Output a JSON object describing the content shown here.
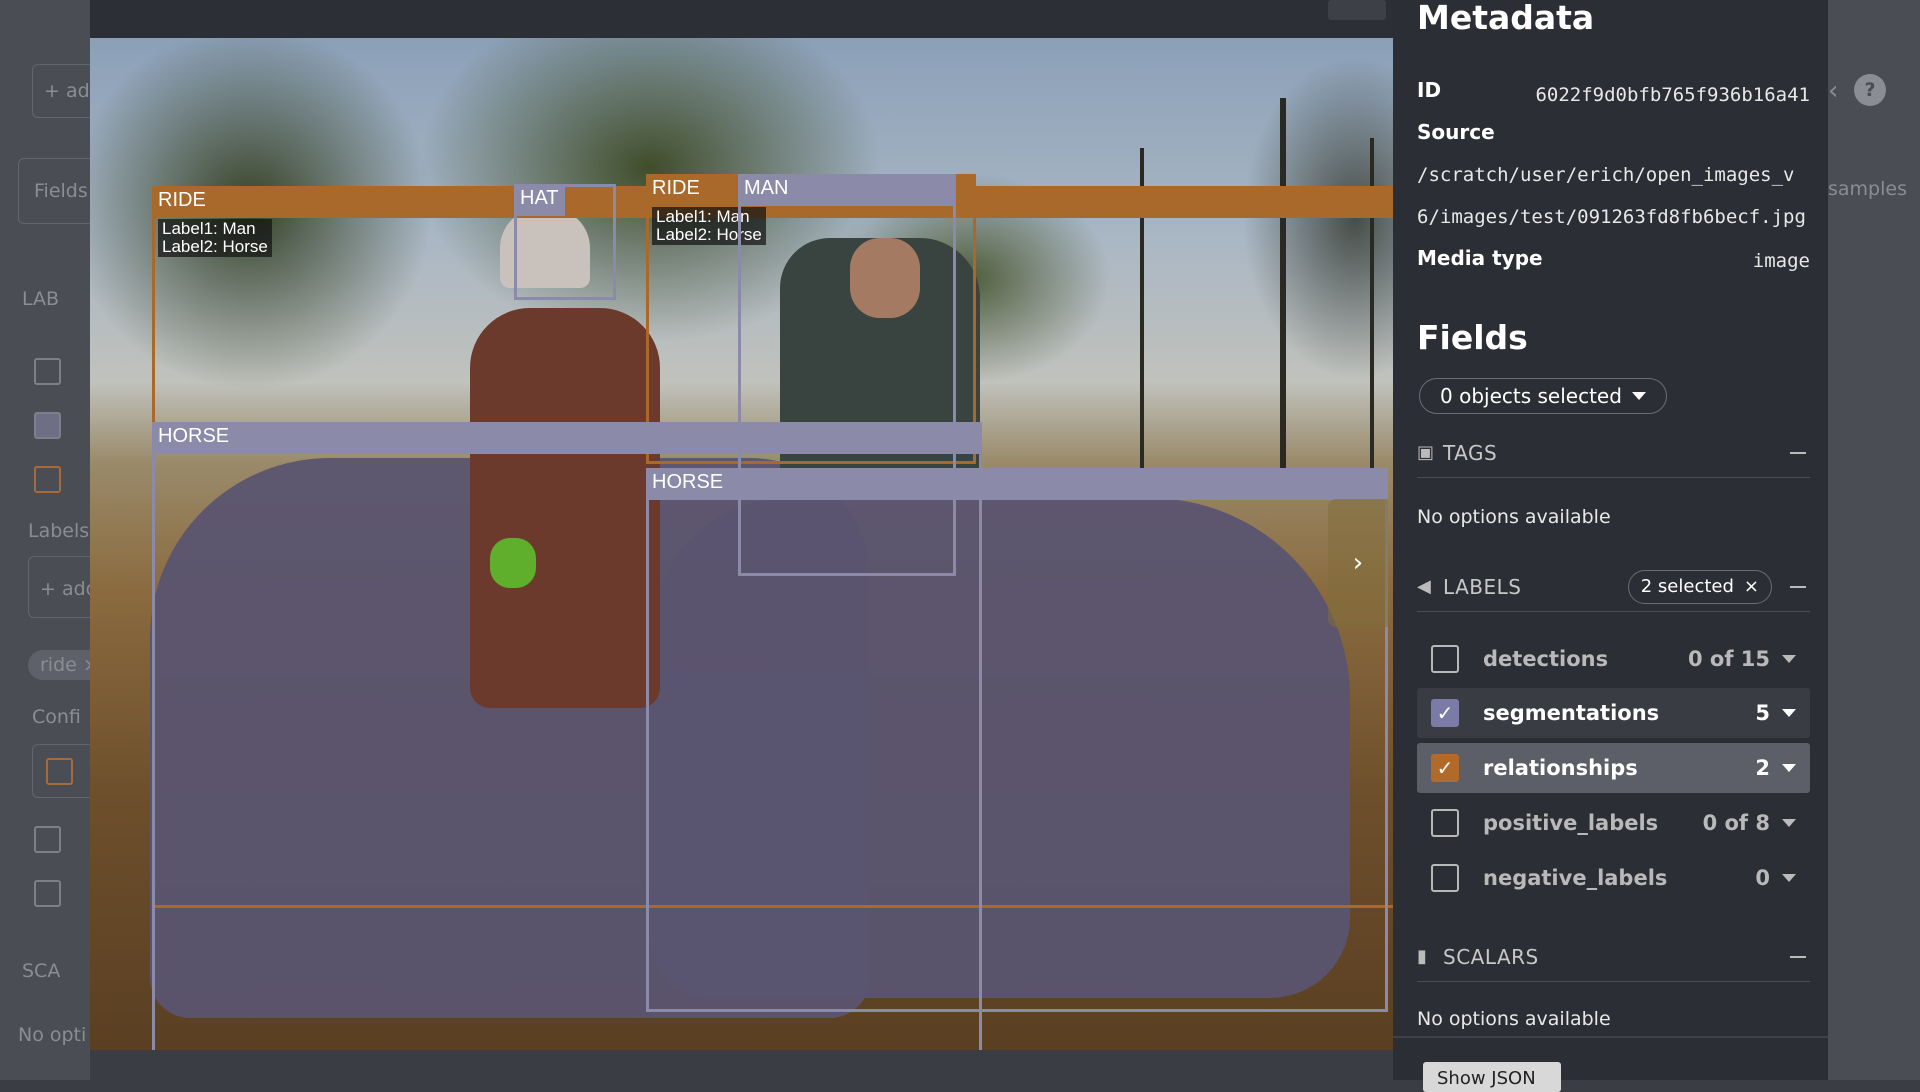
{
  "background_left": {
    "add_button": "+ add",
    "fields_label": "Fields",
    "labels_section": "LAB",
    "labels_filter": "Labels",
    "add_input": "+ add",
    "chip": "ride ×",
    "confidence": "Confi",
    "scalars": "SCA",
    "no_options": "No opti"
  },
  "background_right": {
    "samples_label": "samples",
    "help_icon": "?"
  },
  "viewer": {
    "boxes": [
      {
        "type": "ride",
        "label": "RIDE",
        "sub1": "Label1: Man",
        "sub2": "Label2: Horse"
      },
      {
        "type": "purple",
        "label": "HAT"
      },
      {
        "type": "ride",
        "label": "RIDE",
        "sub1": "Label1: Man",
        "sub2": "Label2: Horse"
      },
      {
        "type": "purple",
        "label": "MAN"
      },
      {
        "type": "purple",
        "label": "HORSE"
      },
      {
        "type": "purple",
        "label": "HORSE"
      }
    ],
    "next_arrow": "›"
  },
  "metadata": {
    "title": "Metadata",
    "id_label": "ID",
    "id_value": "6022f9d0bfb765f936b16a41",
    "source_label": "Source",
    "source_value": "/scratch/user/erich/open_images_v6/images/test/091263fd8fb6becf.jpg",
    "media_type_label": "Media type",
    "media_type_value": "image"
  },
  "fields": {
    "title": "Fields",
    "objects_selected": "0 objects selected",
    "tags": {
      "name": "TAGS",
      "empty": "No options available"
    },
    "labels": {
      "name": "LABELS",
      "selected": "2 selected",
      "items": [
        {
          "name": "detections",
          "count": "0 of 15",
          "checked": false,
          "active": false
        },
        {
          "name": "segmentations",
          "count": "5",
          "checked": true,
          "active": true
        },
        {
          "name": "relationships",
          "count": "2",
          "checked": true,
          "active": true
        },
        {
          "name": "positive_labels",
          "count": "0 of 8",
          "checked": false,
          "active": false
        },
        {
          "name": "negative_labels",
          "count": "0",
          "checked": false,
          "active": false
        }
      ]
    },
    "scalars": {
      "name": "SCALARS",
      "empty": "No options available"
    }
  },
  "bottom_button": "Show JSON",
  "colors": {
    "ride": "#a8692a",
    "purple": "#8b8aa8",
    "segmentations_check": "#7c7ba8",
    "relationships_check": "#b26a2a"
  }
}
